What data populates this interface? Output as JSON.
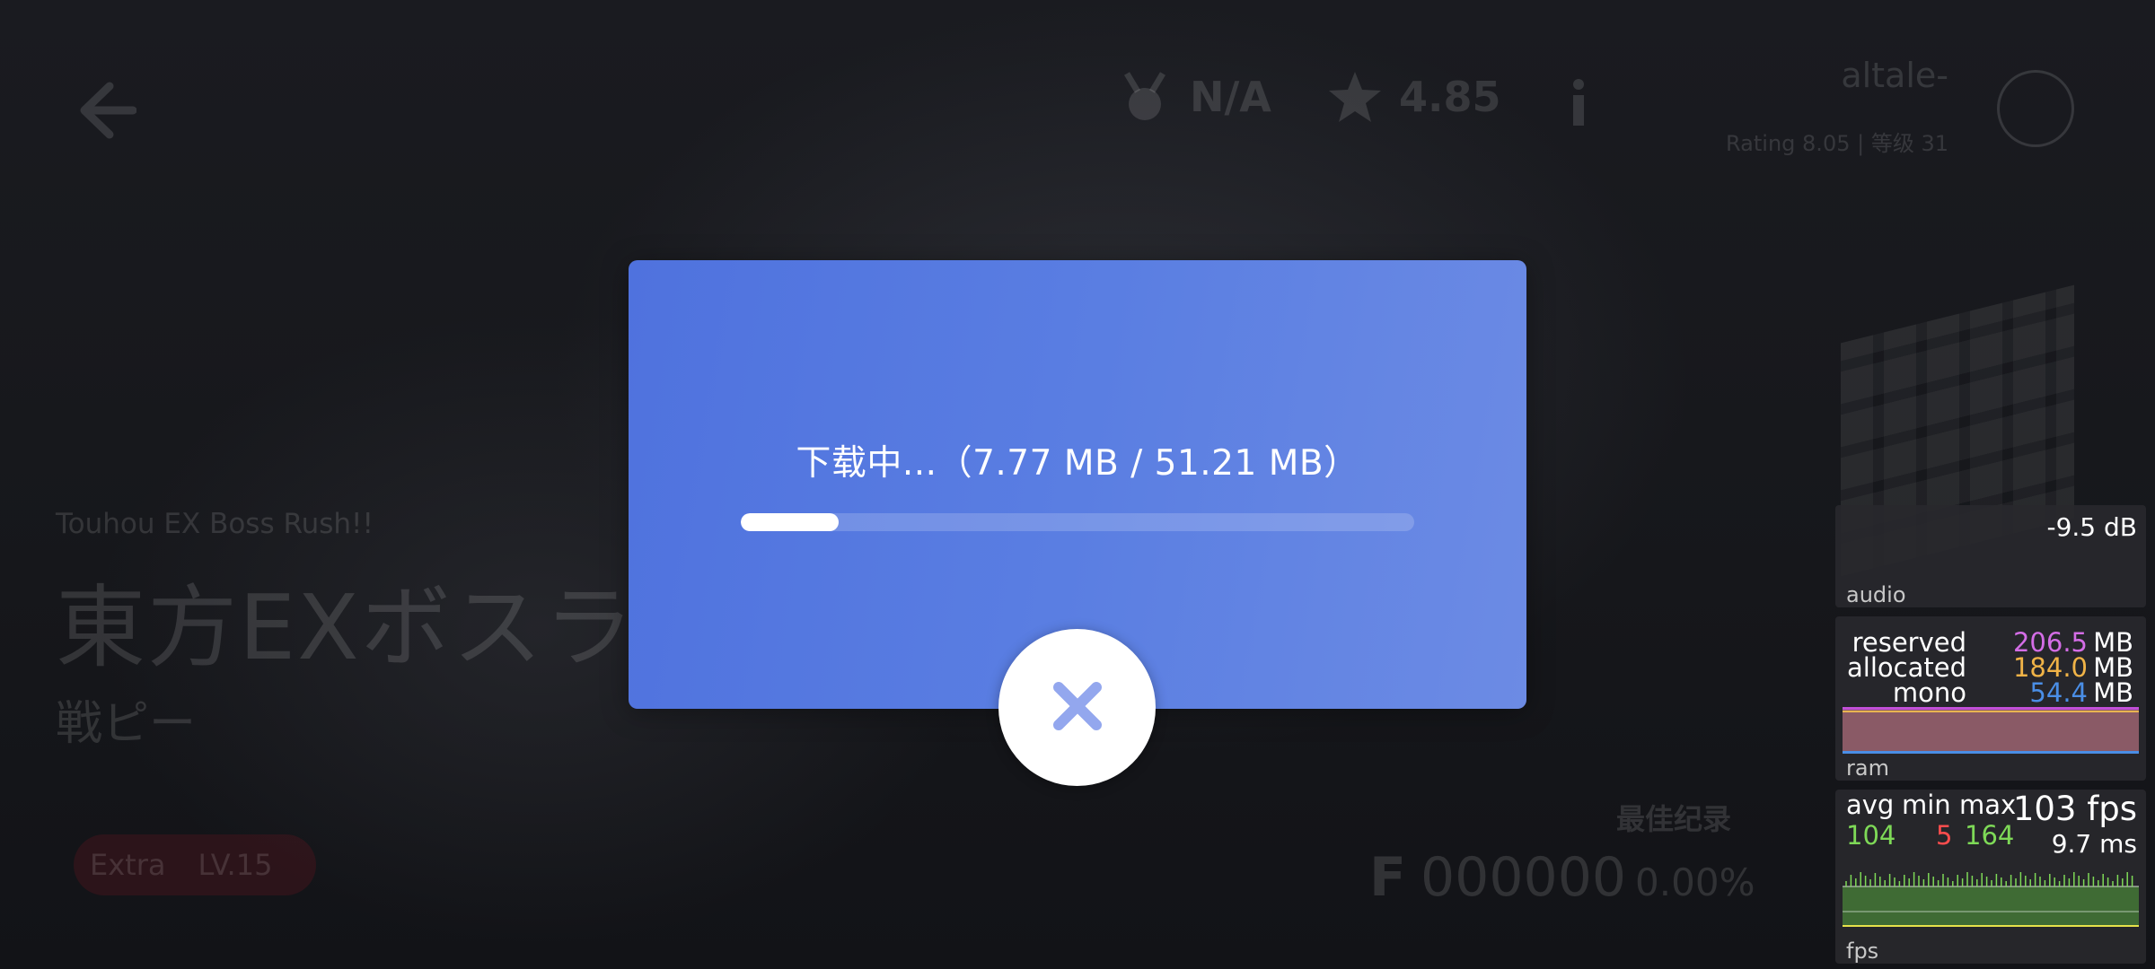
{
  "background": {
    "top": {
      "grade_value": "N/A",
      "rating_value": "4.85",
      "username": "altale-",
      "user_sub": "Rating 8.05 | 等级 31"
    },
    "song": {
      "subtitle": "Touhou EX Boss Rush!!",
      "title": "東方EXボスラ",
      "artist": "戦ピー",
      "difficulty": "Extra",
      "level": "LV.15"
    },
    "best_record": {
      "label": "最佳纪录",
      "grade": "F",
      "score": "000000",
      "accuracy": "0.00%"
    }
  },
  "download_dialog": {
    "status_text": "下载中...（7.77 MB / 51.21 MB）",
    "progress_fraction": 0.145,
    "accent_color": "#5676df"
  },
  "debug_overlay": {
    "audio": {
      "level": "-9.5 dB",
      "label": "audio"
    },
    "ram": {
      "rows": [
        {
          "label": "reserved",
          "value": "206.5",
          "unit": "MB",
          "color": "#d46de6"
        },
        {
          "label": "allocated",
          "value": "184.0",
          "unit": "MB",
          "color": "#f0b347"
        },
        {
          "label": "mono",
          "value": "54.4",
          "unit": "MB",
          "color": "#4a8ee6"
        }
      ],
      "label": "ram"
    },
    "fps": {
      "avg_label": "avg",
      "min_label": "min",
      "max_label": "max",
      "avg": "104",
      "min": "5",
      "max": "164",
      "current": "103 fps",
      "frame_time": "9.7 ms",
      "label": "fps",
      "good_color": "#7ed957",
      "bad_color": "#ff4d4d"
    }
  }
}
